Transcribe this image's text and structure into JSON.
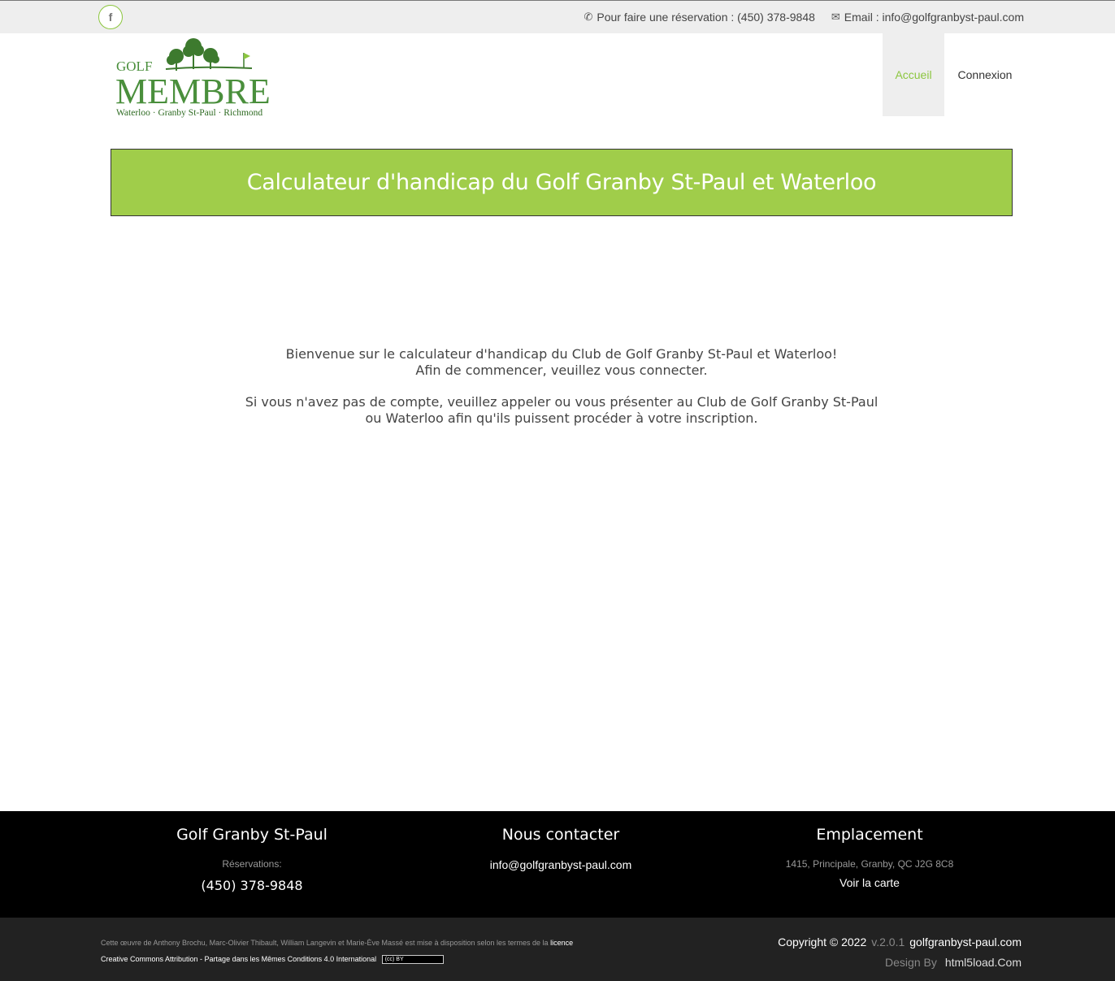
{
  "topbar": {
    "facebook_icon": "facebook-icon",
    "reservation_label": "Pour faire une réservation : (450) 378-9848",
    "email_label": "Email : info@golfgranbyst-paul.com"
  },
  "logo": {
    "golf": "GOLF",
    "membre": "MEMBRE",
    "tagline": "Waterloo · Granby St-Paul · Richmond"
  },
  "nav": {
    "items": [
      {
        "label": "Accueil"
      },
      {
        "label": "Connexion"
      }
    ]
  },
  "banner": {
    "title": "Calculateur d'handicap du Golf Granby St-Paul et Waterloo"
  },
  "welcome": {
    "line1": "Bienvenue sur le calculateur d'handicap du Club de Golf Granby St-Paul et Waterloo!",
    "line2": "Afin de commencer, veuillez vous connecter.",
    "line3": "Si vous n'avez pas de compte, veuillez appeler ou vous présenter au Club de Golf Granby St-Paul",
    "line4": "ou Waterloo afin qu'ils puissent procéder à votre inscription."
  },
  "footer": {
    "col1": {
      "title": "Golf Granby St-Paul",
      "label": "Réservations:",
      "phone": "(450) 378-9848"
    },
    "col2": {
      "title": "Nous contacter",
      "email": "info@golfgranbyst-paul.com"
    },
    "col3": {
      "title": "Emplacement",
      "address": "1415, Principale, Granby, QC J2G 8C8",
      "map_link": "Voir la carte"
    }
  },
  "bottom": {
    "license_text": "Cette œuvre de Anthony Brochu, Marc-Olivier Thibault, William Langevin et Marie-Ève Massé est mise à disposition selon les termes de la",
    "license_link": "licence",
    "license_name": "Creative Commons Attribution - Partage dans les Mêmes Conditions 4.0 International",
    "cc_badge": "(cc) BY",
    "copyright": "Copyright © 2022",
    "version": "v.2.0.1",
    "site": "golfgranbyst-paul.com",
    "design_by": "Design By",
    "designer": "html5load.Com"
  },
  "colors": {
    "accent": "#8cc63f",
    "banner": "#a0cd4a",
    "logo_green": "#4a8f3c"
  }
}
